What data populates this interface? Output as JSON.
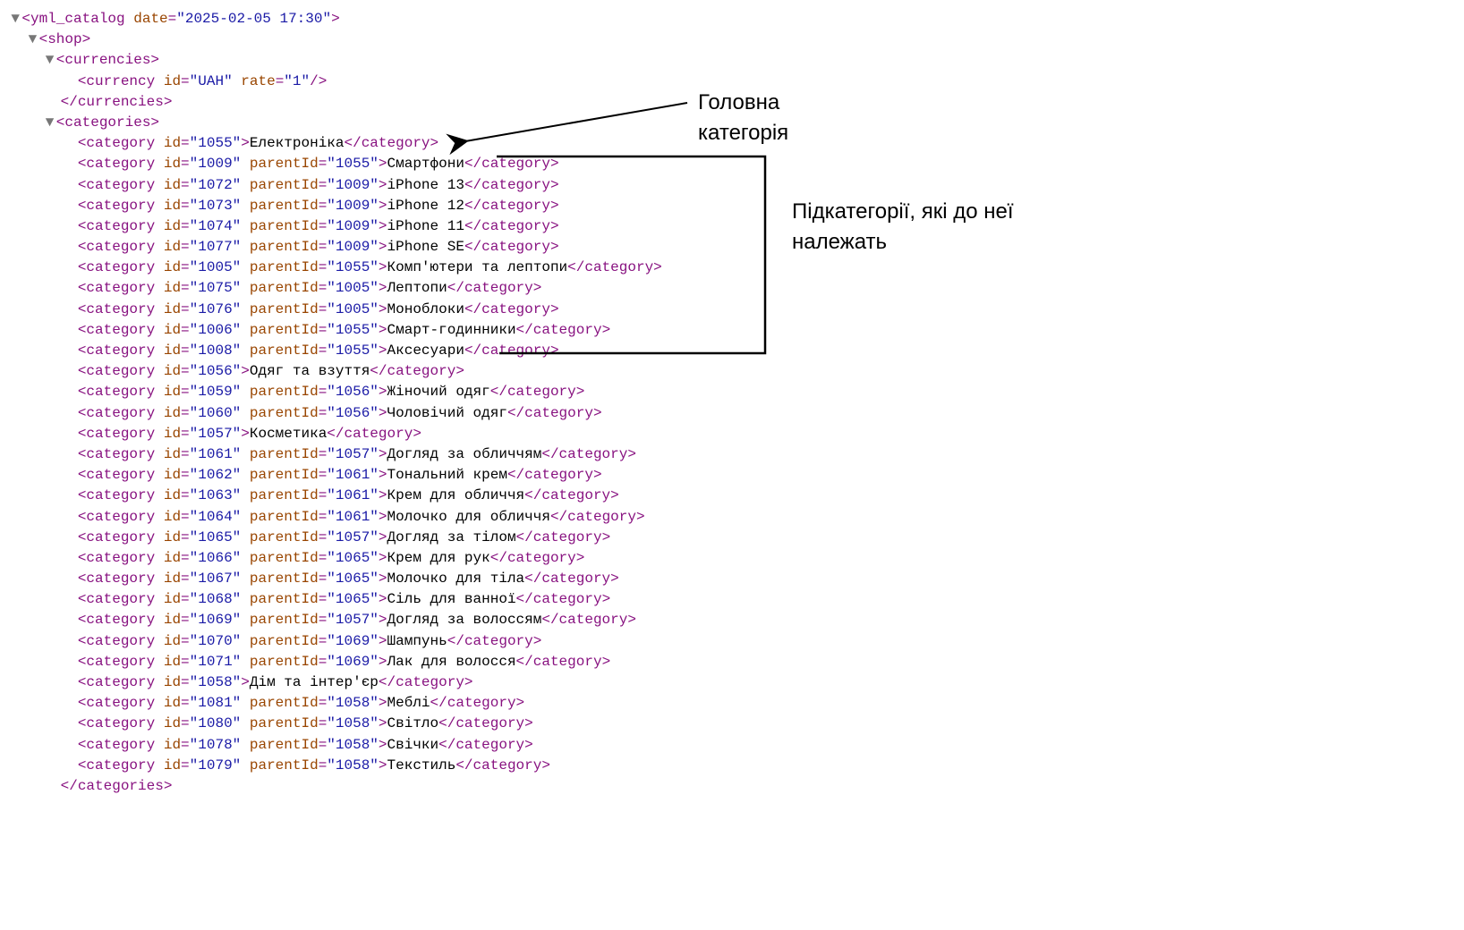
{
  "root": {
    "tag": "yml_catalog",
    "date_attr": "date",
    "date_val": "2025-02-05 17:30"
  },
  "shop_tag": "shop",
  "currencies": {
    "tag": "currencies",
    "currency_tag": "currency",
    "id_attr": "id",
    "id_val": "UAH",
    "rate_attr": "rate",
    "rate_val": "1"
  },
  "categories_tag": "categories",
  "category_tag": "category",
  "id_attr": "id",
  "parentId_attr": "parentId",
  "rows": [
    {
      "id": "1055",
      "parent": null,
      "text": "Електроніка"
    },
    {
      "id": "1009",
      "parent": "1055",
      "text": "Смартфони"
    },
    {
      "id": "1072",
      "parent": "1009",
      "text": "iPhone 13"
    },
    {
      "id": "1073",
      "parent": "1009",
      "text": "iPhone 12"
    },
    {
      "id": "1074",
      "parent": "1009",
      "text": "iPhone 11"
    },
    {
      "id": "1077",
      "parent": "1009",
      "text": "iPhone SE"
    },
    {
      "id": "1005",
      "parent": "1055",
      "text": "Комп'ютери та лептопи"
    },
    {
      "id": "1075",
      "parent": "1005",
      "text": "Лептопи"
    },
    {
      "id": "1076",
      "parent": "1005",
      "text": "Моноблоки"
    },
    {
      "id": "1006",
      "parent": "1055",
      "text": "Смарт-годинники"
    },
    {
      "id": "1008",
      "parent": "1055",
      "text": "Аксесуари"
    },
    {
      "id": "1056",
      "parent": null,
      "text": "Одяг та взуття"
    },
    {
      "id": "1059",
      "parent": "1056",
      "text": "Жіночий одяг"
    },
    {
      "id": "1060",
      "parent": "1056",
      "text": "Чоловічий одяг"
    },
    {
      "id": "1057",
      "parent": null,
      "text": "Косметика"
    },
    {
      "id": "1061",
      "parent": "1057",
      "text": "Догляд за обличчям"
    },
    {
      "id": "1062",
      "parent": "1061",
      "text": "Тональний крем"
    },
    {
      "id": "1063",
      "parent": "1061",
      "text": "Крем для обличчя"
    },
    {
      "id": "1064",
      "parent": "1061",
      "text": "Молочко для обличчя"
    },
    {
      "id": "1065",
      "parent": "1057",
      "text": "Догляд за тілом"
    },
    {
      "id": "1066",
      "parent": "1065",
      "text": "Крем для рук"
    },
    {
      "id": "1067",
      "parent": "1065",
      "text": "Молочко для тіла"
    },
    {
      "id": "1068",
      "parent": "1065",
      "text": "Сіль для ванної"
    },
    {
      "id": "1069",
      "parent": "1057",
      "text": "Догляд за волоссям"
    },
    {
      "id": "1070",
      "parent": "1069",
      "text": "Шампунь"
    },
    {
      "id": "1071",
      "parent": "1069",
      "text": "Лак для волосся"
    },
    {
      "id": "1058",
      "parent": null,
      "text": "Дім та інтер'єр"
    },
    {
      "id": "1081",
      "parent": "1058",
      "text": "Меблі"
    },
    {
      "id": "1080",
      "parent": "1058",
      "text": "Світло"
    },
    {
      "id": "1078",
      "parent": "1058",
      "text": "Свічки"
    },
    {
      "id": "1079",
      "parent": "1058",
      "text": "Текстиль"
    }
  ],
  "annotations": {
    "main": "Головна категорія",
    "sub": "Підкатегорії, які до неї належать"
  }
}
